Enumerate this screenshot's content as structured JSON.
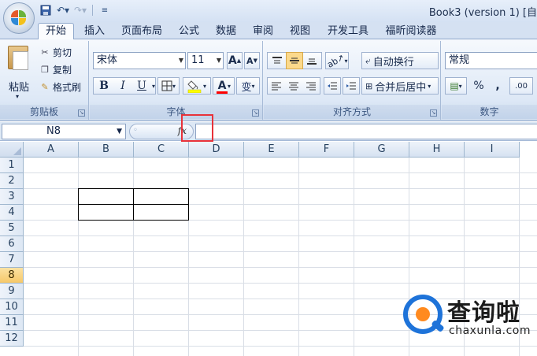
{
  "window": {
    "title": "Book3 (version 1) [自"
  },
  "tabs": [
    {
      "label": "开始",
      "active": true
    },
    {
      "label": "插入"
    },
    {
      "label": "页面布局"
    },
    {
      "label": "公式"
    },
    {
      "label": "数据"
    },
    {
      "label": "审阅"
    },
    {
      "label": "视图"
    },
    {
      "label": "开发工具"
    },
    {
      "label": "福昕阅读器"
    }
  ],
  "ribbon": {
    "clipboard": {
      "label": "剪贴板",
      "paste": "粘贴",
      "cut": "剪切",
      "copy": "复制",
      "format_painter": "格式刷"
    },
    "font": {
      "label": "字体",
      "font_name": "宋体",
      "font_size": "11",
      "grow": "A",
      "shrink": "A",
      "bold": "B",
      "italic": "I",
      "underline": "U",
      "font_color_letter": "A",
      "phonetic": "变",
      "fill_color": "#ffff00",
      "font_color": "#ff0000"
    },
    "alignment": {
      "label": "对齐方式",
      "wrap_text": "自动换行",
      "merge_center": "合并后居中"
    },
    "number": {
      "label": "数字",
      "format": "常规",
      "percent": "%",
      "comma": ",",
      "decimal": ".00"
    }
  },
  "formula_bar": {
    "name_box": "N8",
    "fx": "fx"
  },
  "grid": {
    "columns": [
      "A",
      "B",
      "C",
      "D",
      "E",
      "F",
      "G",
      "H",
      "I"
    ],
    "rows": [
      "1",
      "2",
      "3",
      "4",
      "5",
      "6",
      "7",
      "8",
      "9",
      "10",
      "11",
      "12"
    ],
    "active_row": "8"
  },
  "watermark": {
    "text": "查询啦",
    "domain": "chaxunla.com"
  }
}
